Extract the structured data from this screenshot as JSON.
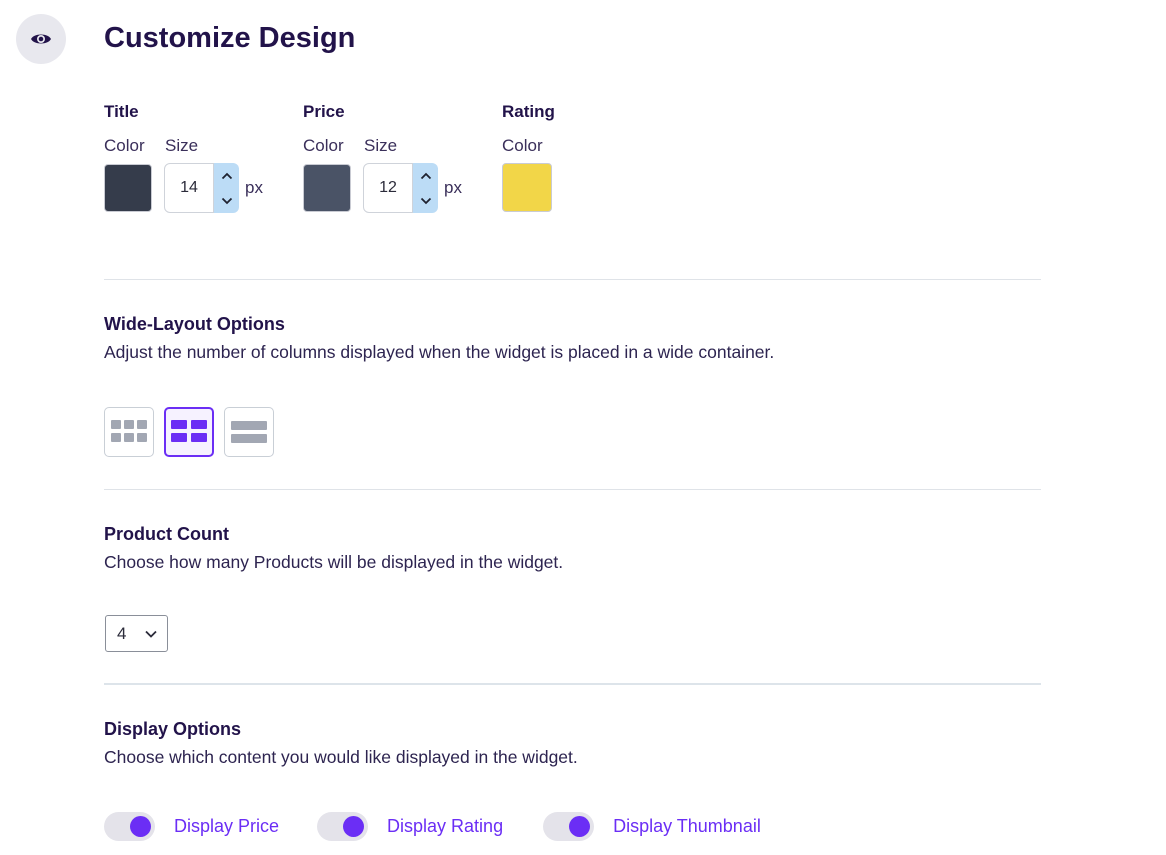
{
  "header": {
    "title": "Customize Design",
    "preview_icon": "eye-icon"
  },
  "style_groups": {
    "title": {
      "label": "Title",
      "color_label": "Color",
      "size_label": "Size",
      "color": "#353c4b",
      "size": "14",
      "unit": "px"
    },
    "price": {
      "label": "Price",
      "color_label": "Color",
      "size_label": "Size",
      "color": "#4a5366",
      "size": "12",
      "unit": "px"
    },
    "rating": {
      "label": "Rating",
      "color_label": "Color",
      "color": "#f2d648"
    }
  },
  "wide_layout": {
    "title": "Wide-Layout Options",
    "description": "Adjust the number of columns displayed when the widget is placed in a wide container.",
    "options": [
      "three-column-grid-icon",
      "two-column-grid-icon",
      "single-column-list-icon"
    ],
    "selected_index": 1
  },
  "product_count": {
    "title": "Product Count",
    "description": "Choose how many Products will be displayed in the widget.",
    "selected": "4"
  },
  "display_options": {
    "title": "Display Options",
    "description": "Choose which content you would like displayed in the widget.",
    "toggles": [
      {
        "label": "Display Price",
        "on": true
      },
      {
        "label": "Display Rating",
        "on": true
      },
      {
        "label": "Display Thumbnail",
        "on": true
      }
    ]
  },
  "colors": {
    "accent": "#6b2ef5",
    "heading": "#22134a",
    "stepper_arrows": "#bcdcf6",
    "layout_icon_inactive": "#a2a7b3"
  }
}
